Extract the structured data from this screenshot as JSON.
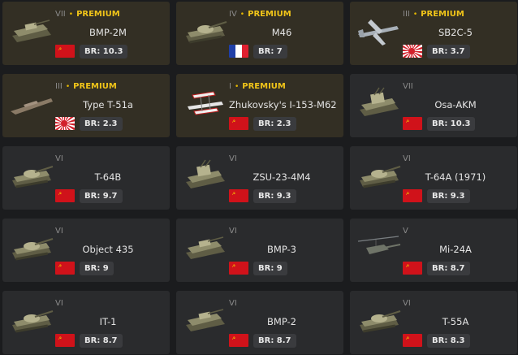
{
  "vehicles": [
    {
      "tier": "VII",
      "premium": true,
      "name": "BMP-2M",
      "nation": "ussr",
      "br": "BR: 10.3",
      "type": "ifv"
    },
    {
      "tier": "IV",
      "premium": true,
      "name": "M46",
      "nation": "france",
      "br": "BR: 7",
      "type": "tank"
    },
    {
      "tier": "III",
      "premium": true,
      "name": "SB2C-5",
      "nation": "japan",
      "br": "BR: 3.7",
      "type": "plane"
    },
    {
      "tier": "III",
      "premium": true,
      "name": "Type T-51a",
      "nation": "japan",
      "br": "BR: 2.3",
      "type": "boat"
    },
    {
      "tier": "I",
      "premium": true,
      "name": "Zhukovsky's I-153-M62",
      "nation": "ussr",
      "br": "BR: 2.3",
      "type": "biplane"
    },
    {
      "tier": "VII",
      "premium": false,
      "name": "Osa-AKM",
      "nation": "ussr",
      "br": "BR: 10.3",
      "type": "spaa"
    },
    {
      "tier": "VI",
      "premium": false,
      "name": "T-64B",
      "nation": "ussr",
      "br": "BR: 9.7",
      "type": "tank"
    },
    {
      "tier": "VI",
      "premium": false,
      "name": "ZSU-23-4M4",
      "nation": "ussr",
      "br": "BR: 9.3",
      "type": "spaa"
    },
    {
      "tier": "VI",
      "premium": false,
      "name": "T-64A (1971)",
      "nation": "ussr",
      "br": "BR: 9.3",
      "type": "tank"
    },
    {
      "tier": "VI",
      "premium": false,
      "name": "Object 435",
      "nation": "ussr",
      "br": "BR: 9",
      "type": "tank"
    },
    {
      "tier": "VI",
      "premium": false,
      "name": "BMP-3",
      "nation": "ussr",
      "br": "BR: 9",
      "type": "ifv"
    },
    {
      "tier": "V",
      "premium": false,
      "name": "Mi-24A",
      "nation": "ussr",
      "br": "BR: 8.7",
      "type": "heli"
    },
    {
      "tier": "VI",
      "premium": false,
      "name": "IT-1",
      "nation": "ussr",
      "br": "BR: 8.7",
      "type": "tank"
    },
    {
      "tier": "VI",
      "premium": false,
      "name": "BMP-2",
      "nation": "ussr",
      "br": "BR: 8.7",
      "type": "ifv"
    },
    {
      "tier": "VI",
      "premium": false,
      "name": "T-55A",
      "nation": "ussr",
      "br": "BR: 8.3",
      "type": "tank"
    }
  ],
  "premium_label": "PREMIUM",
  "colors": {
    "premium_gold": "#f0c419",
    "card_bg": "#2a2b2d",
    "card_premium_bg": "#332f24",
    "page_bg": "#1b1c1e"
  }
}
